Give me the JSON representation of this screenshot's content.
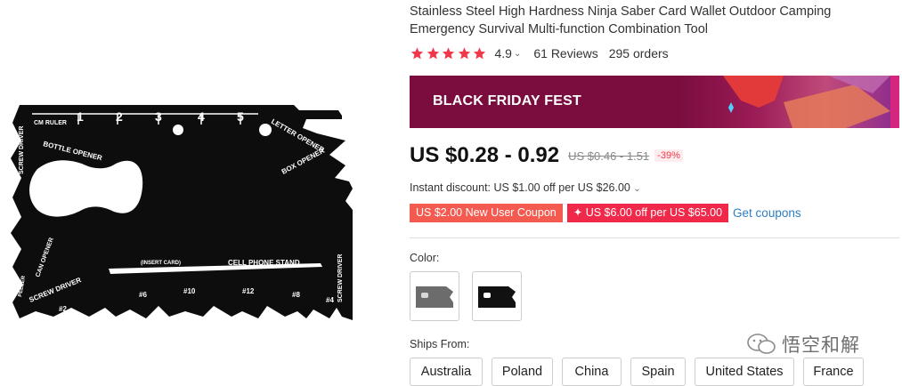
{
  "product": {
    "title": "Stainless Steel High Hardness Ninja Saber Card Wallet Outdoor Camping Emergency Survival Multi-function Combination Tool",
    "rating": "4.9",
    "reviews": "61 Reviews",
    "orders": "295 orders",
    "stars_filled": 5
  },
  "image": {
    "labels": {
      "cm_ruler": "CM RULER",
      "ruler_numbers": [
        "1",
        "2",
        "3",
        "4",
        "5"
      ],
      "bottle_opener": "BOTTLE OPENER",
      "letter_opener": "LETTER OPENER",
      "box_opener": "BOX OPENER",
      "screw_driver_top": "SCREW DRIVER",
      "can_opener": "CAN OPENER",
      "peeler": "PEELER",
      "screw_driver_bottom": "SCREW DRIVER",
      "insert_card": "(INSERT CARD)",
      "cell_phone_stand": "CELL PHONE STAND",
      "screw_driver_right": "SCREW DRIVER",
      "hex": [
        "#2",
        "#6",
        "#10",
        "#12",
        "#8",
        "#4"
      ]
    }
  },
  "banner": {
    "text": "BLACK FRIDAY FEST",
    "bg_color": "#7a0d3e"
  },
  "pricing": {
    "price": "US $0.28 - 0.92",
    "original_price": "US $0.46 - 1.51",
    "discount": "-39%",
    "instant_discount": "Instant discount: US $1.00 off per US $26.00",
    "coupon_new_user": "US $2.00 New User Coupon",
    "coupon_store": "US $6.00 off per US $65.00",
    "get_coupons": "Get coupons"
  },
  "options": {
    "color_label": "Color:",
    "ships_from_label": "Ships From:",
    "ships_from": [
      "Australia",
      "Poland",
      "China",
      "Spain",
      "United States",
      "France"
    ]
  },
  "watermark": {
    "text": "悟空和解"
  },
  "colors": {
    "star": "#f1384b",
    "link": "#2d7ec2",
    "coupon_red": "#f45a4f",
    "coupon_pink": "#f0294a"
  }
}
